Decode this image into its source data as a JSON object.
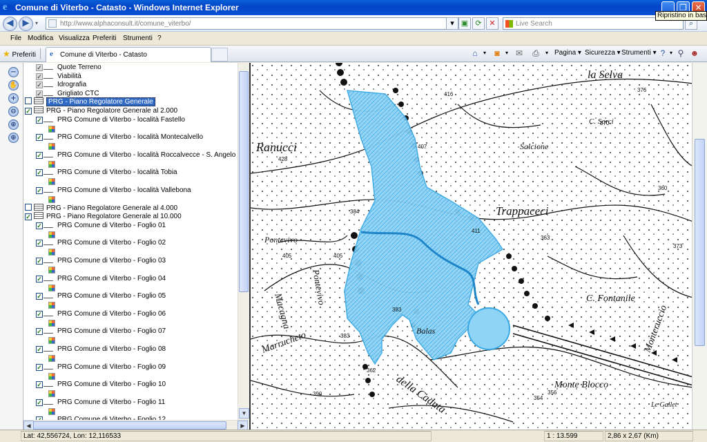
{
  "window": {
    "title": "Comune di Viterbo - Catasto - Windows Internet Explorer",
    "tooltip": "Ripristino in basso",
    "minimize": "_",
    "restore": "❐",
    "close": "✕"
  },
  "address_bar": {
    "url": "http://www.alphaconsult.it/comune_viterbo/",
    "search_placeholder": "Live Search",
    "back": "◀",
    "forward": "▶"
  },
  "menu": [
    "File",
    "Modifica",
    "Visualizza",
    "Preferiti",
    "Strumenti",
    "?"
  ],
  "favorites": {
    "favorites_label": "Preferiti",
    "tab_label": "Comune di Viterbo - Catasto"
  },
  "command_bar": {
    "pagina": "Pagina ▾",
    "sicurezza": "Sicurezza ▾",
    "strumenti": "Strumenti ▾"
  },
  "tools": [
    "zoom-out",
    "pan",
    "zoom-in",
    "zoom-out-area",
    "zoom-full",
    "zoom-in-area"
  ],
  "layers": [
    {
      "label": "Quote Terreno",
      "checked": true,
      "gray": true,
      "type": "line"
    },
    {
      "label": "Viabilità",
      "checked": true,
      "gray": true,
      "type": "line"
    },
    {
      "label": "Idrografia",
      "checked": true,
      "gray": true,
      "type": "line"
    },
    {
      "label": "Grigliato CTC",
      "checked": true,
      "gray": true,
      "type": "line"
    },
    {
      "label": "PRG - Piano Regolatore Generale",
      "checked": false,
      "group": true,
      "selected": true
    },
    {
      "label": "PRG - Piano Regolatore Generale al 2.000",
      "checked": true,
      "group": true
    },
    {
      "label": "PRG Comune di Viterbo - località Fastello",
      "checked": true,
      "type": "line",
      "legend": true
    },
    {
      "label": "PRG Comune di Viterbo - località Montecalvello",
      "checked": true,
      "type": "line",
      "legend": true
    },
    {
      "label": "PRG Comune di Viterbo - località Roccalvecce - S. Angelo",
      "checked": true,
      "type": "line",
      "legend": true
    },
    {
      "label": "PRG Comune di Viterbo - località Tobia",
      "checked": true,
      "type": "line",
      "legend": true
    },
    {
      "label": "PRG Comune di Viterbo - località Vallebona",
      "checked": true,
      "type": "line",
      "legend": true
    },
    {
      "label": "PRG - Piano Regolatore Generale al 4.000",
      "checked": false,
      "group": true
    },
    {
      "label": "PRG - Piano Regolatore Generale al 10.000",
      "checked": true,
      "group": true
    },
    {
      "label": "PRG Comune di Viterbo - Foglio 01",
      "checked": true,
      "type": "line",
      "legend": true
    },
    {
      "label": "PRG Comune di Viterbo - Foglio 02",
      "checked": true,
      "type": "line",
      "legend": true
    },
    {
      "label": "PRG Comune di Viterbo - Foglio 03",
      "checked": true,
      "type": "line",
      "legend": true
    },
    {
      "label": "PRG Comune di Viterbo - Foglio 04",
      "checked": true,
      "type": "line",
      "legend": true
    },
    {
      "label": "PRG Comune di Viterbo - Foglio 05",
      "checked": true,
      "type": "line",
      "legend": true
    },
    {
      "label": "PRG Comune di Viterbo - Foglio 06",
      "checked": true,
      "type": "line",
      "legend": true
    },
    {
      "label": "PRG Comune di Viterbo - Foglio 07",
      "checked": true,
      "type": "line",
      "legend": true
    },
    {
      "label": "PRG Comune di Viterbo - Foglio 08",
      "checked": true,
      "type": "line",
      "legend": true
    },
    {
      "label": "PRG Comune di Viterbo - Foglio 09",
      "checked": true,
      "type": "line",
      "legend": true
    },
    {
      "label": "PRG Comune di Viterbo - Foglio 10",
      "checked": true,
      "type": "line",
      "legend": true
    },
    {
      "label": "PRG Comune di Viterbo - Foglio 11",
      "checked": true,
      "type": "line",
      "legend": true
    },
    {
      "label": "PRG Comune di Viterbo - Foglio 12",
      "checked": true,
      "type": "line",
      "legend": false
    }
  ],
  "map": {
    "place_names": [
      "la Selva",
      "C. Sorci",
      "Salcione",
      "Ranucci",
      "Trappaceci",
      "Pontevivo",
      "C. Fontanile",
      "Monteruccio",
      "Macagna",
      "Pontevivo",
      "Marrucheto",
      "Balas",
      "della Caduta",
      "Monte Blocco",
      "Le Gallet"
    ],
    "elevations": [
      "416",
      "428",
      "407",
      "384",
      "411",
      "405",
      "405",
      "383",
      "383",
      "362",
      "363",
      "360",
      "370",
      "376",
      "373",
      "356",
      "354",
      "390"
    ],
    "highlight_color": "#5ec3f2"
  },
  "status": {
    "coords": "Lat: 42,556724, Lon: 12,116533",
    "scale": "1 : 13.599",
    "extent": "2,86 x 2,67 (Km)"
  }
}
